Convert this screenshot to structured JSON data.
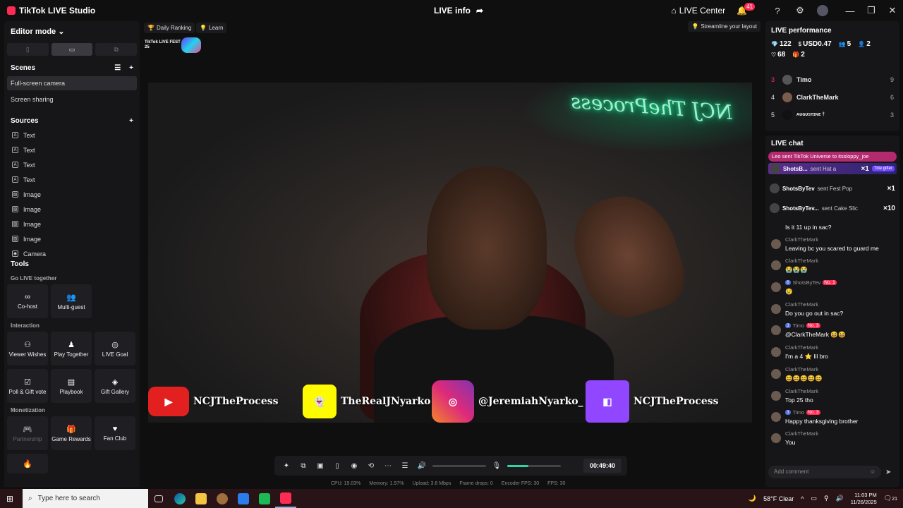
{
  "window": {
    "app_title": "TikTok LIVE Studio",
    "center_title": "LIVE info",
    "live_center": "LIVE Center",
    "notifications": "41"
  },
  "left": {
    "editor_mode": "Editor mode",
    "scenes_title": "Scenes",
    "scenes": [
      "Full-screen camera",
      "Screen sharing"
    ],
    "sources_title": "Sources",
    "sources": [
      {
        "type": "text-icon",
        "label": "Text"
      },
      {
        "type": "text-icon",
        "label": "Text"
      },
      {
        "type": "text-icon",
        "label": "Text"
      },
      {
        "type": "text-icon",
        "label": "Text"
      },
      {
        "type": "image-icon",
        "label": "Image"
      },
      {
        "type": "image-icon",
        "label": "Image"
      },
      {
        "type": "image-icon",
        "label": "Image"
      },
      {
        "type": "image-icon",
        "label": "Image"
      },
      {
        "type": "camera-icon",
        "label": "Camera"
      }
    ]
  },
  "tools": {
    "title": "Tools",
    "go_live_together": "Go LIVE together",
    "cohost": "Co-host",
    "multiguest": "Multi-guest",
    "interaction": "Interaction",
    "viewer_wishes": "Viewer Wishes",
    "play_together": "Play Together",
    "live_goal": "LIVE Goal",
    "poll": "Poll & Gift vote",
    "playbook": "Playbook",
    "gift_gallery": "Gift Gallery",
    "monetization": "Monetization",
    "partnership": "Partnership",
    "game_rewards": "Game Rewards",
    "fan_club": "Fan Club"
  },
  "center": {
    "daily_ranking": "Daily Ranking",
    "learn": "Learn",
    "streamline": "Streamline your layout",
    "fest_text": "TikTok LIVE FEST 25",
    "neon": "NCJ TheProcess",
    "socials": [
      {
        "platform": "YouTube",
        "handle": "NCJTheProcess",
        "color": "#e32020"
      },
      {
        "platform": "Snapchat",
        "handle": "TheRealJNyarko",
        "color": "#fffc00"
      },
      {
        "platform": "Instagram",
        "handle": "@JeremiahNyarko_",
        "color": "#d6249f"
      },
      {
        "platform": "Twitch",
        "handle": "NCJTheProcess",
        "color": "#9146ff"
      }
    ],
    "timer": "00:49:40",
    "volume_level": 0,
    "mic_level": 0.4,
    "stats": {
      "cpu": "CPU: 19.03%",
      "memory": "Memory: 1.97%",
      "upload": "Upload: 3.6 Mbps",
      "drops": "Frame drops: 0",
      "encoder_fps": "Encoder FPS: 30",
      "fps": "FPS: 30"
    }
  },
  "performance": {
    "title": "LIVE performance",
    "diamonds": "122",
    "usd": "USD0.47",
    "viewers": "5",
    "new_followers": "2",
    "likes": "68",
    "gifts": "2",
    "ranking": [
      {
        "rank": "3",
        "name": "Timo",
        "score": "9"
      },
      {
        "rank": "4",
        "name": "ClarkTheMark",
        "score": "6"
      },
      {
        "rank": "5",
        "name": "ᴀᴜɢᴜsᴛɪɴᴇ †",
        "score": "3"
      }
    ]
  },
  "chat": {
    "title": "LIVE chat",
    "banner": "Leo sent TikTok Universe to itssloppy_joe",
    "gifts": [
      {
        "name": "ShotsB...",
        "text": "sent Hat a",
        "count": "×1",
        "tag": "Title gifter"
      },
      {
        "name": "ShotsByTev",
        "text": "sent Fest Pop",
        "count": "×1",
        "tag": ""
      },
      {
        "name": "ShotsByTev...",
        "text": "sent Cake Slic",
        "count": "×10",
        "tag": ""
      }
    ],
    "top_partial": "Is it 11 up in sac?",
    "messages": [
      {
        "who": "ClarkTheMark",
        "text": "Leaving bc you scared to guard me",
        "lvl": "",
        "no": ""
      },
      {
        "who": "ClarkTheMark",
        "text": "😭😭😭",
        "lvl": "",
        "no": ""
      },
      {
        "who": "ShotsByTev",
        "text": "😢",
        "lvl": "6",
        "no": "No. 1"
      },
      {
        "who": "ClarkTheMark",
        "text": "Do you go out in sac?",
        "lvl": "",
        "no": ""
      },
      {
        "who": "Timo",
        "text": "@ClarkTheMark 😆😆",
        "lvl": "3",
        "no": "No. 3"
      },
      {
        "who": "ClarkTheMark",
        "text": "I'm a 4 ⭐ lil bro",
        "lvl": "",
        "no": ""
      },
      {
        "who": "ClarkTheMark",
        "text": "😆😆😆😆😆",
        "lvl": "",
        "no": ""
      },
      {
        "who": "ClarkTheMark",
        "text": "Top 25 tho",
        "lvl": "",
        "no": ""
      },
      {
        "who": "Timo",
        "text": "Happy thanksgiving brother",
        "lvl": "3",
        "no": "No. 3"
      },
      {
        "who": "ClarkTheMark",
        "text": "You",
        "lvl": "",
        "no": ""
      }
    ],
    "placeholder": "Add comment"
  },
  "taskbar": {
    "search": "Type here to search",
    "weather": "58°F  Clear",
    "time": "11:03 PM",
    "date": "11/26/2025",
    "notif": "21"
  }
}
